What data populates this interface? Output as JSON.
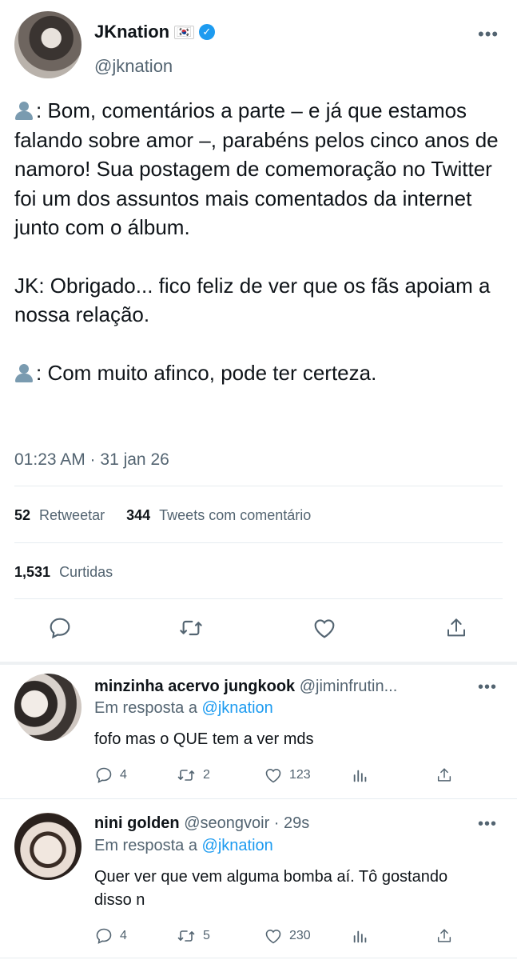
{
  "tweet": {
    "author_name": "JKnation",
    "flag": "🇰🇷",
    "handle": "@jknation",
    "paragraphs": [
      ": Bom, comentários a parte – e já que estamos falando sobre amor –, parabéns pelos cinco anos de namoro! Sua postagem de comemoração no Twitter foi um dos assuntos mais comentados da internet junto com o álbum.",
      "JK: Obrigado... fico feliz de ver que os fãs apoiam a nossa relação.",
      ": Com muito afinco, pode ter certeza."
    ],
    "timestamp": "01:23 AM · 31 jan 26",
    "retweets_count": "52",
    "retweets_label": "Retweetar",
    "quotes_count": "344",
    "quotes_label": "Tweets com comentário",
    "likes_count": "1,531",
    "likes_label": "Curtidas"
  },
  "replies": [
    {
      "name": "minzinha acervo jungkook",
      "handle": "@jiminfrutin...",
      "time": "",
      "reply_prefix": "Em resposta a",
      "reply_to": "@jknation",
      "text": "fofo mas o QUE tem a ver mds",
      "replies": "4",
      "retweets": "2",
      "likes": "123"
    },
    {
      "name": "nini golden",
      "handle": "@seongvoir · 29s",
      "time": "",
      "reply_prefix": "Em resposta a",
      "reply_to": "@jknation",
      "text": "Quer ver que vem alguma bomba aí. Tô gostando disso n",
      "replies": "4",
      "retweets": "5",
      "likes": "230"
    }
  ],
  "colors": {
    "accent": "#1d9bf0",
    "secondary_text": "#536471",
    "divider": "#e6ecf0"
  },
  "icons": [
    "reply-icon",
    "retweet-icon",
    "like-icon",
    "share-icon",
    "analytics-icon",
    "more-icon",
    "verified-icon"
  ]
}
